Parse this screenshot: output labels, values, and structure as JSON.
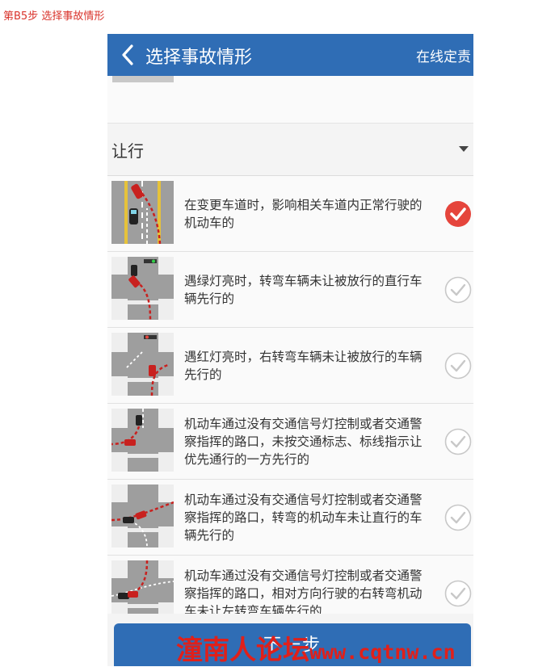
{
  "caption": "第B5步  选择事故情形",
  "navbar": {
    "back_icon": "chevron-left-icon",
    "title": "选择事故情形",
    "right_label": "在线定责"
  },
  "section": {
    "title": "让行",
    "caret_icon": "caret-down-icon"
  },
  "options": [
    {
      "text": "在变更车道时，影响相关车道内正常行驶的机动车的",
      "selected": true
    },
    {
      "text": "遇绿灯亮时，转弯车辆未让被放行的直行车辆先行的",
      "selected": false
    },
    {
      "text": "遇红灯亮时，右转弯车辆未让被放行的车辆先行的",
      "selected": false
    },
    {
      "text": "机动车通过没有交通信号灯控制或者交通警察指挥的路口，未按交通标志、标线指示让优先通行的一方先行的",
      "selected": false
    },
    {
      "text": "机动车通过没有交通信号灯控制或者交通警察指挥的路口，转弯的机动车未让直行的车辆先行的",
      "selected": false
    },
    {
      "text": "机动车通过没有交通信号灯控制或者交通警察指挥的路口，相对方向行驶的右转弯机动车未让左转弯车辆先行的",
      "selected": false
    }
  ],
  "next_button": {
    "label": "下一步"
  },
  "watermark": {
    "cn": "潼南人论坛",
    "url": "www.cqtnw.cn"
  },
  "colors": {
    "navbar": "#2f6db5",
    "check_selected": "#e5453c",
    "caption": "#d9332b",
    "watermark": "#e0201a"
  }
}
